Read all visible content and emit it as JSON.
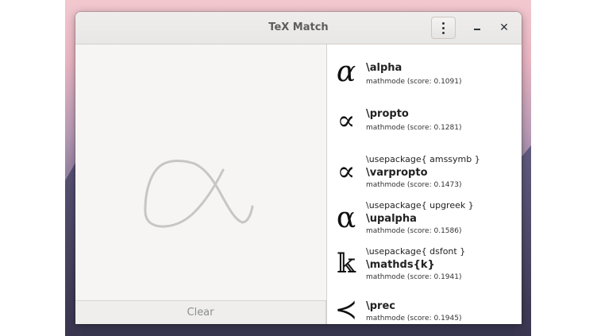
{
  "window": {
    "title": "TeX Match",
    "menu_icon": "vertical-ellipsis-icon",
    "minimize_icon": "minimize-icon",
    "close_glyph": "✕"
  },
  "canvas": {
    "stroke_color": "#c8c6c3"
  },
  "clear_button": {
    "label": "Clear"
  },
  "results": [
    {
      "glyph": "α",
      "package": "",
      "command": "\\alpha",
      "meta": "mathmode (score: 0.1091)"
    },
    {
      "glyph": "∝",
      "package": "",
      "command": "\\propto",
      "meta": "mathmode (score: 0.1281)"
    },
    {
      "glyph": "∝",
      "package": "\\usepackage{ amssymb }",
      "command": "\\varpropto",
      "meta": "mathmode (score: 0.1473)"
    },
    {
      "glyph": "α",
      "package": "\\usepackage{ upgreek }",
      "command": "\\upalpha",
      "meta": "mathmode (score: 0.1586)"
    },
    {
      "glyph": "𝕜",
      "package": "\\usepackage{ dsfont }",
      "command": "\\mathds{k}",
      "meta": "mathmode (score: 0.1941)"
    },
    {
      "glyph": "≺",
      "package": "",
      "command": "\\prec",
      "meta": "mathmode (score: 0.1945)"
    }
  ]
}
